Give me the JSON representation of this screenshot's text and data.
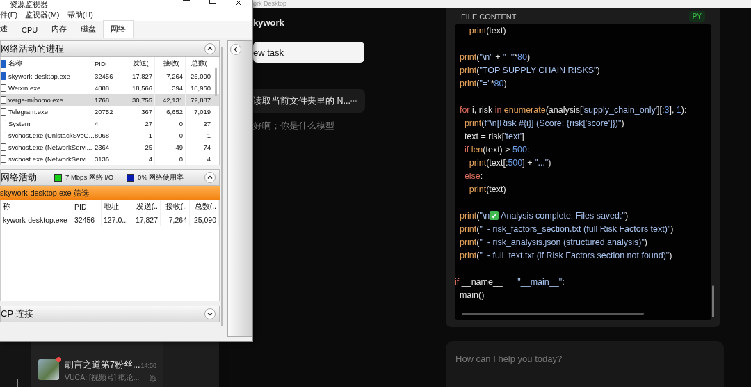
{
  "resource_monitor": {
    "title": "资源监视器",
    "menu": [
      "件(F)",
      "监视器(M)",
      "帮助(H)"
    ],
    "tabs": [
      {
        "label": "述",
        "selected": false
      },
      {
        "label": "CPU",
        "selected": false
      },
      {
        "label": "内存",
        "selected": false
      },
      {
        "label": "磁盘",
        "selected": false
      },
      {
        "label": "网络",
        "selected": true
      }
    ],
    "processes": {
      "title": "网络活动的进程",
      "expanded": true,
      "header_checked": true,
      "columns": [
        "名称",
        "PID",
        "发送(..",
        "接收(..",
        "总数(.."
      ],
      "rows": [
        {
          "name": "skywork-desktop.exe",
          "pid": "32456",
          "sent": "17,827",
          "received": "7,264",
          "total": "25,090",
          "checked": true,
          "selected": false
        },
        {
          "name": "Weixin.exe",
          "pid": "4888",
          "sent": "18,566",
          "received": "394",
          "total": "18,960",
          "checked": false,
          "selected": false
        },
        {
          "name": "verge-mihomo.exe",
          "pid": "1768",
          "sent": "30,755",
          "received": "42,131",
          "total": "72,887",
          "checked": false,
          "selected": true
        },
        {
          "name": "Telegram.exe",
          "pid": "20752",
          "sent": "367",
          "received": "6,652",
          "total": "7,019",
          "checked": false,
          "selected": false
        },
        {
          "name": "System",
          "pid": "4",
          "sent": "27",
          "received": "0",
          "total": "27",
          "checked": false,
          "selected": false
        },
        {
          "name": "svchost.exe (UnistackSvcG...",
          "pid": "8068",
          "sent": "1",
          "received": "0",
          "total": "1",
          "checked": false,
          "selected": false
        },
        {
          "name": "svchost.exe (NetworkServi...",
          "pid": "2364",
          "sent": "25",
          "received": "49",
          "total": "74",
          "checked": false,
          "selected": false
        },
        {
          "name": "svchost.exe (NetworkServi...",
          "pid": "3136",
          "sent": "4",
          "received": "0",
          "total": "4",
          "checked": false,
          "selected": false
        }
      ]
    },
    "activity": {
      "title": "网络活动",
      "expanded": true,
      "legend": [
        {
          "label": "7 Mbps 网络 I/O",
          "color": "#18d018"
        },
        {
          "label": "0% 网络使用率",
          "color": "#0a1cb0"
        }
      ],
      "filter": "skywork-desktop.exe 筛选",
      "columns": [
        "称",
        "PID",
        "地址",
        "发送(..",
        "接收(..",
        "总数(.."
      ],
      "rows": [
        {
          "cells": [
            "kywork-desktop.exe",
            "32456",
            "127.0...",
            "17,827",
            "7,264",
            "25,090"
          ]
        }
      ]
    },
    "tcp": {
      "title": "CP 连接",
      "expanded": false
    }
  },
  "chat_list": {
    "items": [
      {
        "title": "胡言之道第7粉丝...",
        "time": "14:58",
        "preview": "VUCA: [视频号] 概论...",
        "unread": true,
        "muted": true
      }
    ]
  },
  "skywork": {
    "window_title": "ork Desktop",
    "brand": "kywork",
    "new_task": "ew task",
    "tasks": [
      {
        "title": "读取当前文件夹里的 N...",
        "selected": true
      },
      {
        "title": "好啊；你是什么模型",
        "selected": false
      }
    ],
    "file_panel": {
      "title": "FILE CONTENT",
      "language": "PY",
      "lines": [
        {
          "kind": "code",
          "tokens": [
            {
              "kind": "fn",
              "text": "      print"
            },
            {
              "kind": "plain",
              "text": "(text)"
            }
          ]
        },
        {
          "kind": "blank"
        },
        {
          "kind": "code",
          "tokens": [
            {
              "kind": "fn",
              "text": "  print"
            },
            {
              "kind": "plain",
              "text": "("
            },
            {
              "kind": "str",
              "text": "\"\\n\""
            },
            {
              "kind": "plain",
              "text": " + "
            },
            {
              "kind": "str",
              "text": "\"=\""
            },
            {
              "kind": "plain",
              "text": "*"
            },
            {
              "kind": "num",
              "text": "80"
            },
            {
              "kind": "plain",
              "text": ")"
            }
          ]
        },
        {
          "kind": "code",
          "tokens": [
            {
              "kind": "fn",
              "text": "  print"
            },
            {
              "kind": "plain",
              "text": "("
            },
            {
              "kind": "str",
              "text": "\"TOP SUPPLY CHAIN RISKS\""
            },
            {
              "kind": "plain",
              "text": ")"
            }
          ]
        },
        {
          "kind": "code",
          "tokens": [
            {
              "kind": "fn",
              "text": "  print"
            },
            {
              "kind": "plain",
              "text": "("
            },
            {
              "kind": "str",
              "text": "\"=\""
            },
            {
              "kind": "plain",
              "text": "*"
            },
            {
              "kind": "num",
              "text": "80"
            },
            {
              "kind": "plain",
              "text": ")"
            }
          ]
        },
        {
          "kind": "blank"
        },
        {
          "kind": "code",
          "tokens": [
            {
              "kind": "kw",
              "text": "  for"
            },
            {
              "kind": "plain",
              "text": " i, risk "
            },
            {
              "kind": "kw",
              "text": "in"
            },
            {
              "kind": "fn",
              "text": " enumerate"
            },
            {
              "kind": "plain",
              "text": "(analysis["
            },
            {
              "kind": "str",
              "text": "'supply_chain_only'"
            },
            {
              "kind": "plain",
              "text": "][:"
            },
            {
              "kind": "num",
              "text": "3"
            },
            {
              "kind": "plain",
              "text": "], "
            },
            {
              "kind": "num",
              "text": "1"
            },
            {
              "kind": "plain",
              "text": "):"
            }
          ]
        },
        {
          "kind": "code",
          "tokens": [
            {
              "kind": "fn",
              "text": "    print"
            },
            {
              "kind": "plain",
              "text": "("
            },
            {
              "kind": "str",
              "text": "f\"\\n[Risk #{i}] (Score: {risk['score']})\""
            },
            {
              "kind": "plain",
              "text": ")"
            }
          ]
        },
        {
          "kind": "code",
          "tokens": [
            {
              "kind": "plain",
              "text": "    text = risk["
            },
            {
              "kind": "str",
              "text": "'text'"
            },
            {
              "kind": "plain",
              "text": "]"
            }
          ]
        },
        {
          "kind": "code",
          "tokens": [
            {
              "kind": "kw",
              "text": "    if"
            },
            {
              "kind": "fn",
              "text": " len"
            },
            {
              "kind": "plain",
              "text": "(text) > "
            },
            {
              "kind": "num",
              "text": "500"
            },
            {
              "kind": "plain",
              "text": ":"
            }
          ]
        },
        {
          "kind": "code",
          "tokens": [
            {
              "kind": "fn",
              "text": "      print"
            },
            {
              "kind": "plain",
              "text": "(text[:"
            },
            {
              "kind": "num",
              "text": "500"
            },
            {
              "kind": "plain",
              "text": "] + "
            },
            {
              "kind": "str",
              "text": "\"...\""
            },
            {
              "kind": "plain",
              "text": ")"
            }
          ]
        },
        {
          "kind": "code",
          "tokens": [
            {
              "kind": "kw",
              "text": "    else"
            },
            {
              "kind": "plain",
              "text": ":"
            }
          ]
        },
        {
          "kind": "code",
          "tokens": [
            {
              "kind": "fn",
              "text": "      print"
            },
            {
              "kind": "plain",
              "text": "(text)"
            }
          ]
        },
        {
          "kind": "blank"
        },
        {
          "kind": "code",
          "tokens": [
            {
              "kind": "fn",
              "text": "  print"
            },
            {
              "kind": "plain",
              "text": "("
            },
            {
              "kind": "str",
              "text": "\"\\n"
            },
            {
              "kind": "check"
            },
            {
              "kind": "str",
              "text": " Analysis complete. Files saved:\""
            },
            {
              "kind": "plain",
              "text": ")"
            }
          ]
        },
        {
          "kind": "code",
          "tokens": [
            {
              "kind": "fn",
              "text": "  print"
            },
            {
              "kind": "plain",
              "text": "("
            },
            {
              "kind": "str",
              "text": "\"  - risk_factors_section.txt (full Risk Factors text)\""
            },
            {
              "kind": "plain",
              "text": ")"
            }
          ]
        },
        {
          "kind": "code",
          "tokens": [
            {
              "kind": "fn",
              "text": "  print"
            },
            {
              "kind": "plain",
              "text": "("
            },
            {
              "kind": "str",
              "text": "\"  - risk_analysis.json (structured analysis)\""
            },
            {
              "kind": "plain",
              "text": ")"
            }
          ]
        },
        {
          "kind": "code",
          "tokens": [
            {
              "kind": "fn",
              "text": "  print"
            },
            {
              "kind": "plain",
              "text": "("
            },
            {
              "kind": "str",
              "text": "\"  - full_text.txt (if Risk Factors section not found)\""
            },
            {
              "kind": "plain",
              "text": ")"
            }
          ]
        },
        {
          "kind": "blank"
        },
        {
          "kind": "code",
          "tokens": [
            {
              "kind": "kw",
              "text": "if"
            },
            {
              "kind": "plain",
              "text": " __name__ == "
            },
            {
              "kind": "str",
              "text": "\"__main__\""
            },
            {
              "kind": "plain",
              "text": ":"
            }
          ]
        },
        {
          "kind": "code",
          "tokens": [
            {
              "kind": "plain",
              "text": "  main()"
            }
          ]
        }
      ]
    },
    "composer": {
      "placeholder": "How can I help you today?"
    }
  }
}
